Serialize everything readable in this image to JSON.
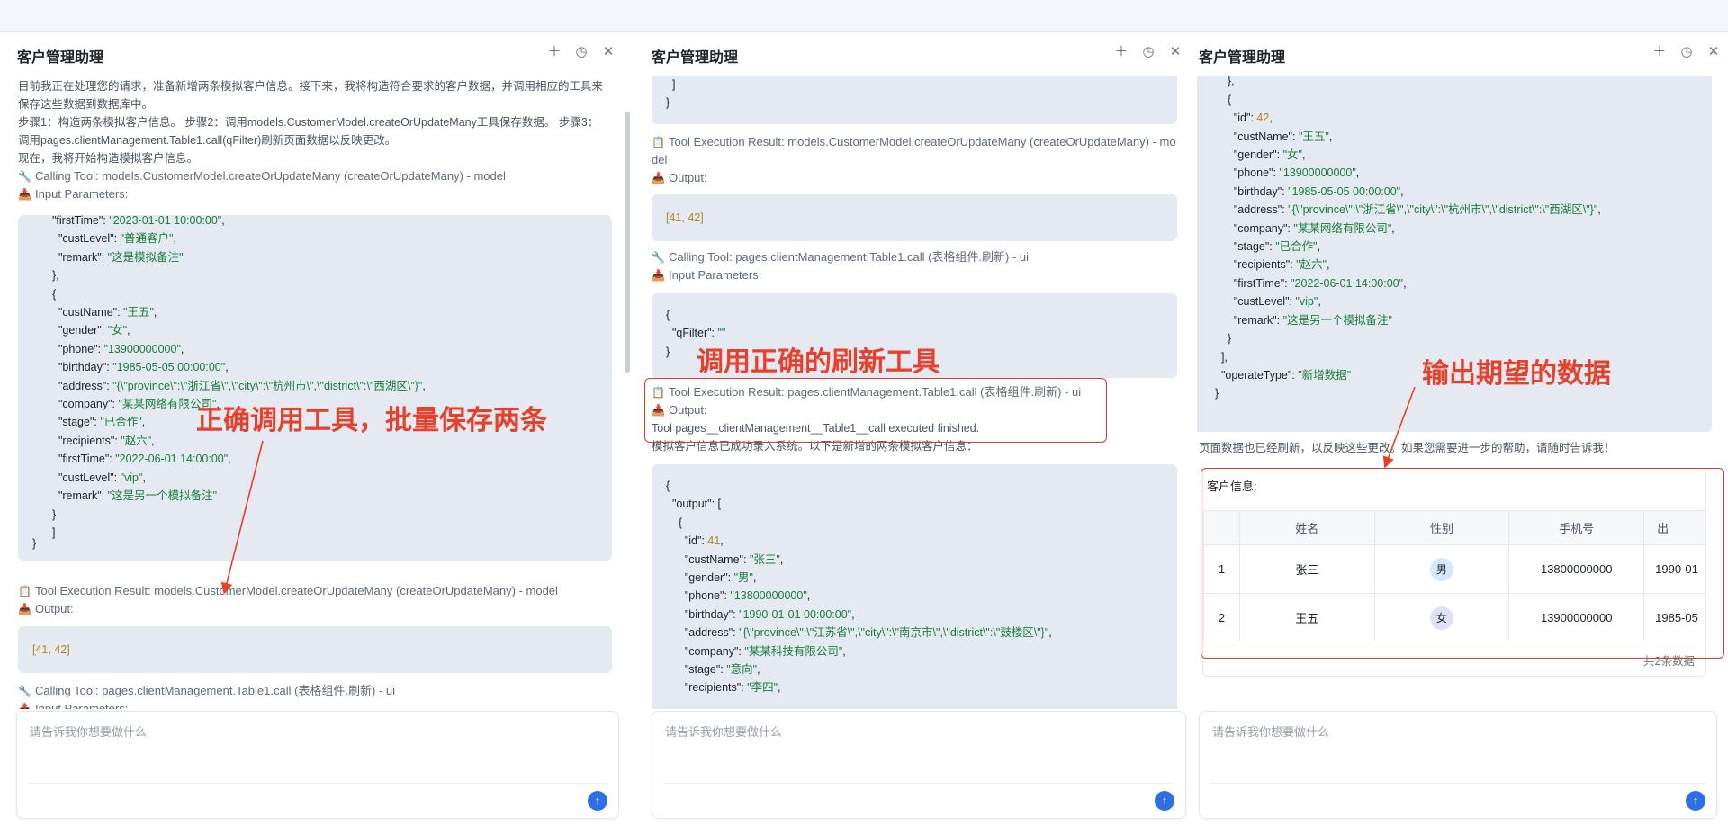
{
  "title": "客户管理助理",
  "input_placeholder": "请告诉我你想要做什么",
  "send_icon": "arrow-up-icon",
  "header_icons": [
    "plus-icon",
    "history-icon",
    "close-icon"
  ],
  "p1": {
    "intro": "目前我正在处理您的请求，准备新增两条模拟客户信息。接下来，我将构造符合要求的客户数据，并调用相应的工具来保存这些数据到数据库中。",
    "steps": "步骤1：构造两条模拟客户信息。 步骤2：调用models.CustomerModel.createOrUpdateMany工具保存数据。 步骤3：调用pages.clientManagement.Table1.call(qFilter)刷新页面数据以反映更改。",
    "now": "现在，我将开始构造模拟客户信息。",
    "calling1": "Calling Tool: models.CustomerModel.createOrUpdateMany (createOrUpdateMany) - model",
    "input_params": "Input Parameters:",
    "result1": "Tool Execution Result: models.CustomerModel.createOrUpdateMany (createOrUpdateMany) - model",
    "output": "Output:",
    "output_val": "[41, 42]",
    "calling2": "Calling Tool: pages.clientManagement.Table1.call (表格组件.刷新) - ui",
    "input_params2": "Input Parameters:",
    "annotation": "正确调用工具，批量保存两条"
  },
  "p2": {
    "result1a": "Tool Execution Result: models.CustomerModel.createOrUpdateMany (createOrUpdateMany) - mo",
    "result1b": "del",
    "output": "Output:",
    "output_val": "[41, 42]",
    "calling2": "Calling Tool: pages.clientManagement.Table1.call (表格组件.刷新) - ui",
    "input_params": "Input Parameters:",
    "result2": "Tool Execution Result: pages.clientManagement.Table1.call (表格组件.刷新) - ui",
    "output2": "Output:",
    "finished": "Tool pages__clientManagement__Table1__call executed finished.",
    "success": "模拟客户信息已成功录入系统。以下是新增的两条模拟客户信息：",
    "annotation": "调用正确的刷新工具"
  },
  "p3": {
    "refreshed": "页面数据也已经刷新，以反映这些更改。如果您需要进一步的帮助，请随时告诉我！",
    "table_title": "客户信息:",
    "headers": [
      "姓名",
      "性别",
      "手机号",
      "出"
    ],
    "rows": [
      {
        "idx": "1",
        "name": "张三",
        "gender": "男",
        "phone": "13800000000",
        "birth": "1990-01"
      },
      {
        "idx": "2",
        "name": "王五",
        "gender": "女",
        "phone": "13900000000",
        "birth": "1985-05"
      }
    ],
    "total": "共2条数据",
    "annotation": "输出期望的数据"
  }
}
